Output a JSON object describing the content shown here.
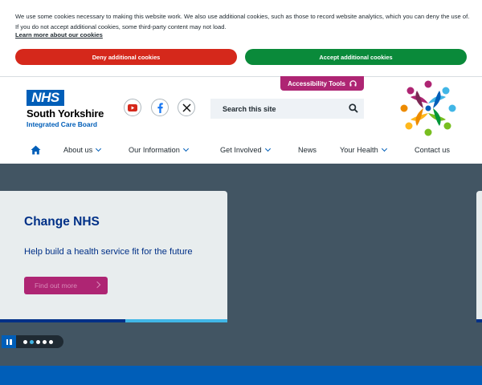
{
  "cookie_banner": {
    "text": "We use some cookies necessary to making this website work. We also use additional cookies, such as those to record website analytics, which you can deny the use of. If you do not accept additional cookies, some third-party content may not load.",
    "learn_more": "Learn more about our cookies",
    "deny_label": "Deny additional cookies",
    "accept_label": "Accept additional cookies"
  },
  "header": {
    "accessibility_label": "Accessibility Tools",
    "logo_text": "NHS",
    "org_name": "South Yorkshire",
    "org_sub": "Integrated Care Board",
    "social_icons": [
      "youtube-icon",
      "facebook-icon",
      "x-icon"
    ],
    "search_placeholder": "Search this site"
  },
  "nav": {
    "items": [
      {
        "label": "About us",
        "dropdown": true
      },
      {
        "label": "Our Information",
        "dropdown": true
      },
      {
        "label": "Get Involved",
        "dropdown": true
      },
      {
        "label": "News",
        "dropdown": false
      },
      {
        "label": "Your Health",
        "dropdown": true
      },
      {
        "label": "Contact us",
        "dropdown": false
      }
    ]
  },
  "hero": {
    "card_title": "Change NHS",
    "card_subtitle": "Help build a health service fit for the future",
    "button_label": "Find out more",
    "slide_count": 5,
    "active_slide": 2
  },
  "colors": {
    "nhs_blue": "#005eb8",
    "dark_blue": "#003087",
    "pink": "#ae2573",
    "deny_red": "#d5281b",
    "accept_green": "#0a8a3a",
    "hero_bg": "#425563"
  }
}
